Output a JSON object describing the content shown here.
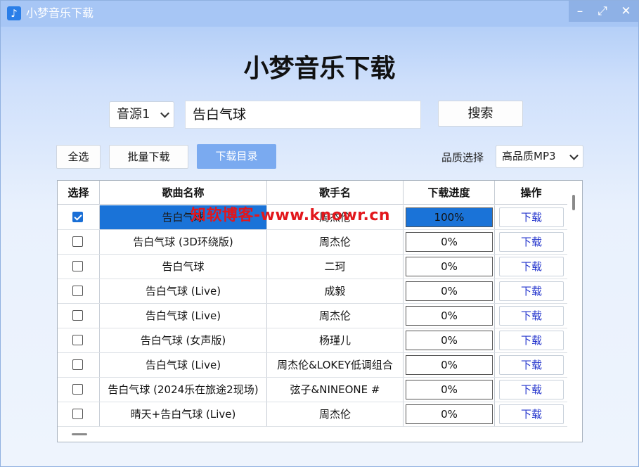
{
  "window": {
    "title": "小梦音乐下载",
    "controls": {
      "minimize": "–",
      "maximize": "⤢",
      "close": "✕"
    }
  },
  "heading": "小梦音乐下载",
  "search": {
    "source": "音源1",
    "query": "告白气球",
    "button": "搜索"
  },
  "toolbar": {
    "select_all": "全选",
    "batch_download": "批量下载",
    "download_dir": "下载目录",
    "quality_label": "品质选择",
    "quality_value": "高品质MP3"
  },
  "table": {
    "headers": [
      "选择",
      "歌曲名称",
      "歌手名",
      "下载进度",
      "操作"
    ],
    "action_label": "下载",
    "rows": [
      {
        "checked": true,
        "song": "告白气球",
        "artist": "周杰伦",
        "progress": "100%",
        "progress_value": 1.0
      },
      {
        "checked": false,
        "song": "告白气球 (3D环绕版)",
        "artist": "周杰伦",
        "progress": "0%",
        "progress_value": 0
      },
      {
        "checked": false,
        "song": "告白气球",
        "artist": "二珂",
        "progress": "0%",
        "progress_value": 0
      },
      {
        "checked": false,
        "song": "告白气球 (Live)",
        "artist": "成毅",
        "progress": "0%",
        "progress_value": 0
      },
      {
        "checked": false,
        "song": "告白气球 (Live)",
        "artist": "周杰伦",
        "progress": "0%",
        "progress_value": 0
      },
      {
        "checked": false,
        "song": "告白气球 (女声版)",
        "artist": "杨瑾儿",
        "progress": "0%",
        "progress_value": 0
      },
      {
        "checked": false,
        "song": "告白气球 (Live)",
        "artist": "周杰伦&LOKEY低调组合",
        "progress": "0%",
        "progress_value": 0
      },
      {
        "checked": false,
        "song": "告白气球 (2024乐在旅途2现场)",
        "artist": "弦子&NINEONE #",
        "progress": "0%",
        "progress_value": 0
      },
      {
        "checked": false,
        "song": "晴天+告白气球 (Live)",
        "artist": "周杰伦",
        "progress": "0%",
        "progress_value": 0
      }
    ]
  },
  "watermark": "知软博客-www.knowr.cn",
  "colors": {
    "accent": "#1a73d8",
    "title_bar": "#a7c6f5",
    "download_link": "#2233cc"
  }
}
